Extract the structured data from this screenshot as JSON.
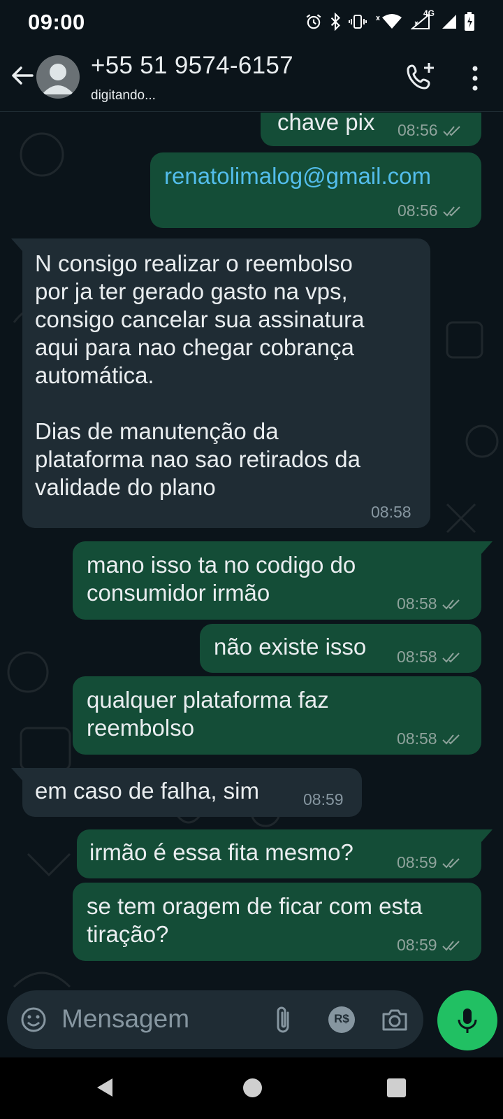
{
  "status_bar": {
    "time": "09:00",
    "network_label": "4G",
    "icons": [
      "alarm-icon",
      "bluetooth-icon",
      "vibrate-icon",
      "wifi-icon",
      "signal-icon",
      "battery-icon"
    ]
  },
  "header": {
    "contact_name": "+55 51 9574-6157",
    "contact_status": "digitando...",
    "icons": [
      "back-arrow-icon",
      "avatar-icon",
      "add-call-icon",
      "more-vert-icon"
    ]
  },
  "messages": [
    {
      "id": "m1",
      "direction": "outgoing",
      "text": "chave pix",
      "time": "08:56",
      "status": "read"
    },
    {
      "id": "m2",
      "direction": "outgoing",
      "text": "renatolimalog@gmail.com",
      "link": true,
      "time": "08:56",
      "status": "read"
    },
    {
      "id": "m3",
      "direction": "incoming",
      "text": "N consigo realizar o reembolso\npor ja ter gerado gasto na vps,\nconsigo cancelar sua assinatura\naqui para nao chegar cobrança\nautomática.\n\nDias de manutenção da\nplataforma nao sao retirados da\nvalidade do plano",
      "time": "08:58"
    },
    {
      "id": "m4",
      "direction": "outgoing",
      "text": "mano isso ta no codigo do\nconsumidor irmão",
      "time": "08:58",
      "status": "read"
    },
    {
      "id": "m5",
      "direction": "outgoing",
      "text": "não existe isso",
      "time": "08:58",
      "status": "read"
    },
    {
      "id": "m6",
      "direction": "outgoing",
      "text": "qualquer plataforma faz\nreembolso",
      "time": "08:58",
      "status": "read"
    },
    {
      "id": "m7",
      "direction": "incoming",
      "text": "em caso de falha, sim",
      "time": "08:59"
    },
    {
      "id": "m8",
      "direction": "outgoing",
      "text": "irmão é essa fita mesmo?",
      "time": "08:59",
      "status": "read"
    },
    {
      "id": "m9",
      "direction": "outgoing",
      "text": "se tem oragem de ficar com esta\ntiração?",
      "time": "08:59",
      "status": "read"
    }
  ],
  "composer": {
    "placeholder": "Mensagem",
    "pix_label": "R$",
    "icons": [
      "emoji-icon",
      "attach-icon",
      "pix-payment-icon",
      "camera-icon",
      "mic-icon"
    ]
  },
  "colors": {
    "background": "#0b141a",
    "outgoing_bubble": "#144d37",
    "incoming_bubble": "#1f2c34",
    "link": "#53bdeb",
    "accent_green": "#21c063"
  }
}
